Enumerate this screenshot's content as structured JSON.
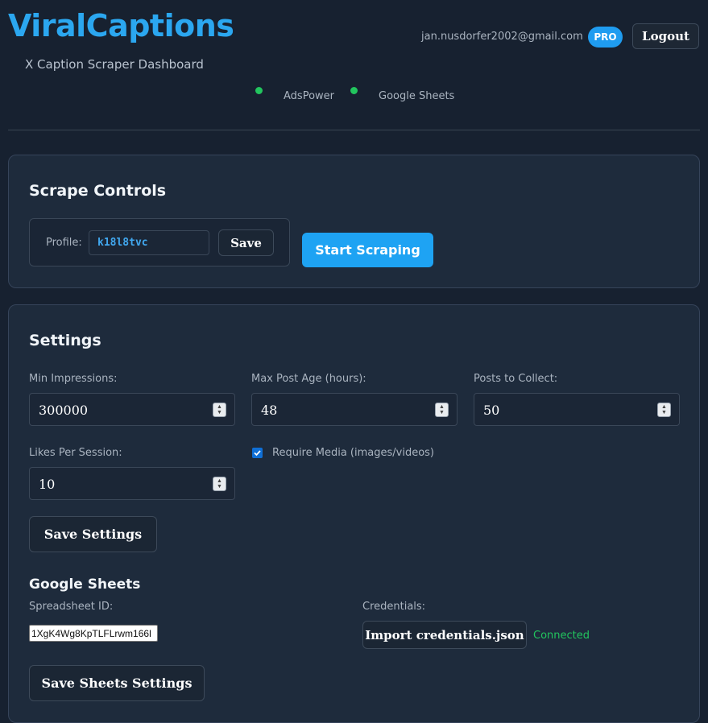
{
  "header": {
    "brand": "ViralCaptions",
    "subtitle": "X Caption Scraper Dashboard",
    "user_email": "jan.nusdorfer2002@gmail.com",
    "plan_badge": "PRO",
    "logout_label": "Logout",
    "status": [
      {
        "label": "AdsPower",
        "state": "online",
        "color": "#22c55e"
      },
      {
        "label": "Google Sheets",
        "state": "online",
        "color": "#22c55e"
      }
    ]
  },
  "scrape_controls": {
    "title": "Scrape Controls",
    "profile_label": "Profile:",
    "profile_value": "k18l8tvc",
    "save_label": "Save",
    "start_label": "Start Scraping"
  },
  "settings": {
    "title": "Settings",
    "min_impressions": {
      "label": "Min Impressions:",
      "value": "300000"
    },
    "max_post_age": {
      "label": "Max Post Age (hours):",
      "value": "48"
    },
    "posts_to_collect": {
      "label": "Posts to Collect:",
      "value": "50"
    },
    "likes_per_session": {
      "label": "Likes Per Session:",
      "value": "10"
    },
    "require_media": {
      "label": "Require Media (images/videos)",
      "checked": true
    },
    "save_label": "Save Settings"
  },
  "google_sheets": {
    "title": "Google Sheets",
    "spreadsheet_label": "Spreadsheet ID:",
    "spreadsheet_value": "1XgK4Wg8KpTLFLrwm166l",
    "credentials_label": "Credentials:",
    "import_label": "Import credentials.json",
    "connection_status": "Connected",
    "save_label": "Save Sheets Settings"
  },
  "colors": {
    "accent": "#1ea3f3",
    "status_ok": "#22c55e",
    "background": "#172130",
    "card": "#1e2b3c"
  }
}
